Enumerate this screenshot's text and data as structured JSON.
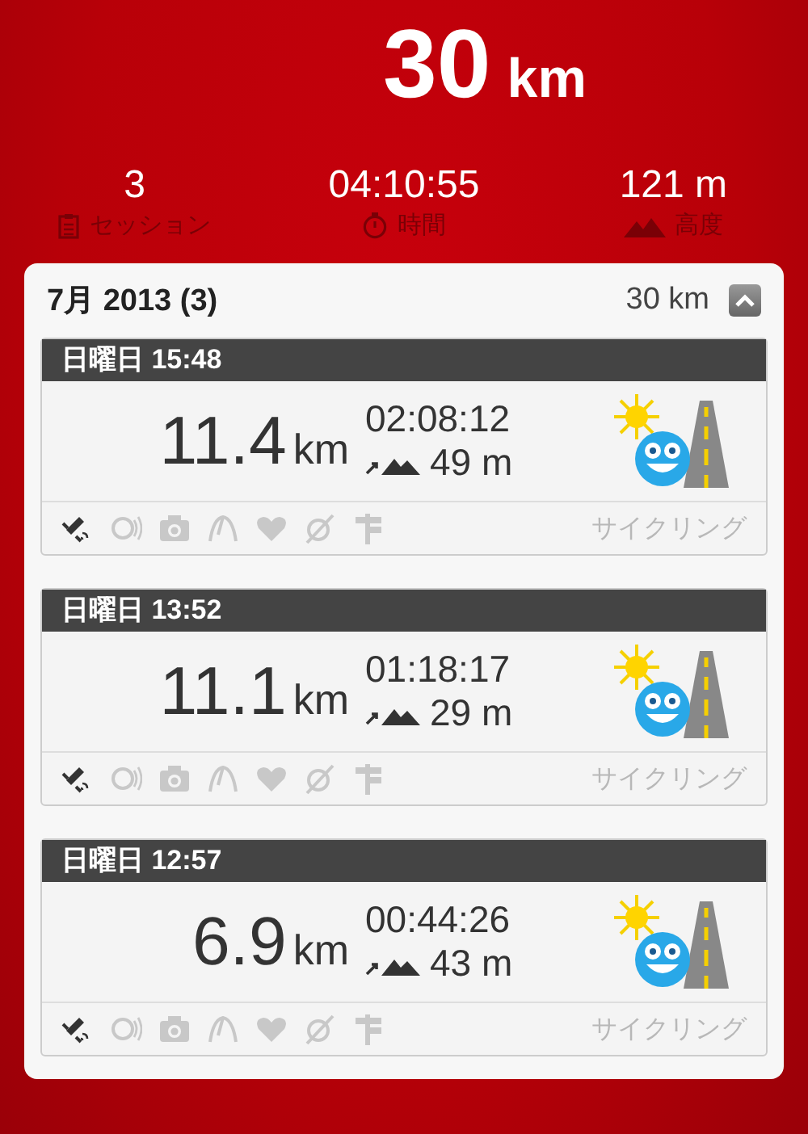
{
  "total": {
    "value": "30",
    "unit": "km"
  },
  "stats": [
    {
      "kind": "sessions",
      "value": "3",
      "label": "セッション"
    },
    {
      "kind": "time",
      "value": "04:10:55",
      "label": "時間"
    },
    {
      "kind": "altitude",
      "value": "121 m",
      "label": "高度"
    }
  ],
  "month": {
    "title": "7月 2013 (3)",
    "distance": "30 km",
    "expanded": true
  },
  "sessions": [
    {
      "header": "日曜日 15:48",
      "distance": "11.4",
      "unit": "km",
      "duration": "02:08:12",
      "ascent": "49 m",
      "sport": "サイクリング",
      "features": [
        {
          "kind": "gps",
          "active": true
        },
        {
          "kind": "sensor",
          "active": false
        },
        {
          "kind": "photo",
          "active": false
        },
        {
          "kind": "speed",
          "active": false
        },
        {
          "kind": "heart",
          "active": false
        },
        {
          "kind": "route",
          "active": false
        },
        {
          "kind": "signpost",
          "active": false
        }
      ]
    },
    {
      "header": "日曜日 13:52",
      "distance": "11.1",
      "unit": "km",
      "duration": "01:18:17",
      "ascent": "29 m",
      "sport": "サイクリング",
      "features": [
        {
          "kind": "gps",
          "active": true
        },
        {
          "kind": "sensor",
          "active": false
        },
        {
          "kind": "photo",
          "active": false
        },
        {
          "kind": "speed",
          "active": false
        },
        {
          "kind": "heart",
          "active": false
        },
        {
          "kind": "route",
          "active": false
        },
        {
          "kind": "signpost",
          "active": false
        }
      ]
    },
    {
      "header": "日曜日 12:57",
      "distance": "6.9",
      "unit": "km",
      "duration": "00:44:26",
      "ascent": "43 m",
      "sport": "サイクリング",
      "features": [
        {
          "kind": "gps",
          "active": true
        },
        {
          "kind": "sensor",
          "active": false
        },
        {
          "kind": "photo",
          "active": false
        },
        {
          "kind": "speed",
          "active": false
        },
        {
          "kind": "heart",
          "active": false
        },
        {
          "kind": "route",
          "active": false
        },
        {
          "kind": "signpost",
          "active": false
        }
      ]
    }
  ]
}
